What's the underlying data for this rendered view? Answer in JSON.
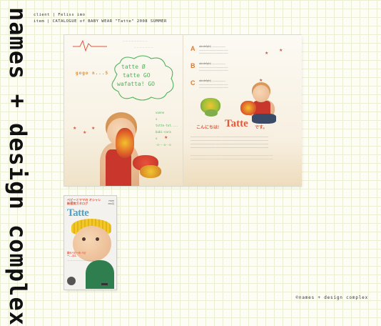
{
  "side_title": "names + design complex",
  "meta": {
    "client_line": "client | Feliss imo",
    "item_line": "item | CATALOGUE of BABY WEAR  \"Tatte\" 2008 SUMMER"
  },
  "footer": "©names + design complex",
  "spread": {
    "left": {
      "gogo": "gogo n...5",
      "cloud_lines": [
        "tatte Ø",
        "tatte GO",
        "wafatta! GO"
      ],
      "notes": [
        "vanne",
        "x",
        "totte-tot....",
        "babi-sara",
        "x",
        "-o---o--o"
      ]
    },
    "right": {
      "sections": [
        {
          "letter": "A",
          "text": [
            "abcdefghij ...................",
            "........................................",
            "........................................"
          ]
        },
        {
          "letter": "B",
          "text": [
            "abcdefghij ...................",
            "........................................",
            "........................................"
          ]
        },
        {
          "letter": "C",
          "text": [
            "abcdefghij ...................",
            "........................................",
            "........................................"
          ]
        }
      ],
      "hello_pre": "こんにちは!",
      "hello_brand": "Tatte",
      "hello_post": "です。"
    }
  },
  "cover": {
    "subtitle": "ベビーとママの オシャレ新感覚カタログ",
    "price": "FREE\n380円",
    "title": "Tatte",
    "feature": "夏のベビーの ベビー...ネル",
    "blurb": "................................................"
  },
  "colors": {
    "grid": "#e9efd2",
    "accent_orange": "#e07a2c",
    "accent_red": "#e05a3a",
    "accent_green": "#4db35a",
    "cover_blue": "#4da3c9"
  }
}
